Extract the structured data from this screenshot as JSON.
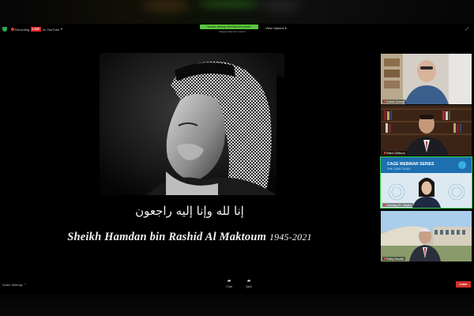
{
  "topbar": {
    "recording_label": "Recording",
    "live_badge": "LIVE",
    "live_target": "on YouTube",
    "banner_title": "You are viewing Sam Mazuri's screen",
    "banner_sub": "Request Remote Control",
    "view_options": "View Options",
    "colors": {
      "live": "#e02828",
      "banner": "#5cc43e",
      "shield": "#2fa84f"
    }
  },
  "slide": {
    "calligraphy": "إنا لله وإنا إليه راجعون",
    "memorial_name": "Sheikh Hamdan bin Rashid Al Maktoum",
    "memorial_years": "1945-2021"
  },
  "participants": [
    {
      "name": "Zahid Gulzar"
    },
    {
      "name": "Rami Zeitoun"
    },
    {
      "name": "Zachary D. Hayes"
    },
    {
      "name": "Rafiq Naufal"
    }
  ],
  "participant3_slide": {
    "title": "CAGE WEBINAR SERIES",
    "subtitle": "THE CAGE TALKS"
  },
  "bottombar": {
    "audio_settings": "Audio Settings",
    "chat_label": "Chat",
    "qa_label": "Q&A",
    "leave_label": "Leave",
    "colors": {
      "leave": "#d0302b",
      "active_speaker": "#38d64a"
    }
  }
}
